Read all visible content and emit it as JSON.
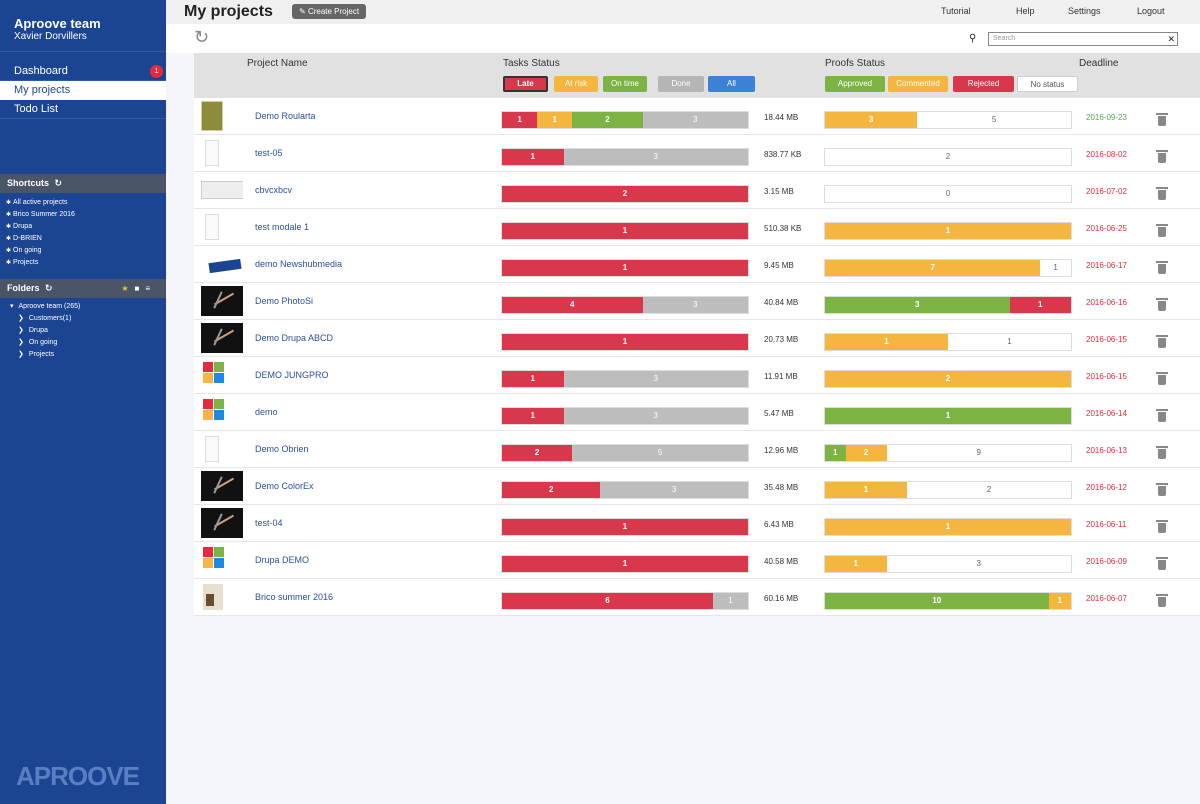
{
  "sidebar": {
    "team_name": "Aproove team",
    "user_name": "Xavier Dorvillers",
    "nav": [
      {
        "label": "Dashboard",
        "badge": "1"
      },
      {
        "label": "My projects"
      },
      {
        "label": "Todo List"
      }
    ],
    "shortcuts_title": "Shortcuts",
    "shortcuts": [
      "All active projects",
      "Brico Summer 2016",
      "Drupa",
      "D-BRIEN",
      "On going",
      "Projects"
    ],
    "folders_title": "Folders",
    "folder_root": "Aproove team (265)",
    "folders": [
      "Customers(1)",
      "Drupa",
      "On going",
      "Projects"
    ],
    "logo": "APROOVE"
  },
  "topbar": {
    "title": "My projects",
    "create_label": "Create Project",
    "links": [
      "Tutorial",
      "Help",
      "Settings",
      "Logout"
    ]
  },
  "search": {
    "placeholder": "Search"
  },
  "header": {
    "project_name": "Project Name",
    "tasks_status": "Tasks Status",
    "proofs_status": "Proofs Status",
    "deadline": "Deadline",
    "task_filters": [
      {
        "label": "Late",
        "color": "#d9374b",
        "selected": true
      },
      {
        "label": "At risk",
        "color": "#f4b63f"
      },
      {
        "label": "On time",
        "color": "#7cb342"
      },
      {
        "label": "Done",
        "color": "#b5b5b5"
      },
      {
        "label": "All",
        "color": "#3b82d6"
      }
    ],
    "proof_filters": [
      {
        "label": "Approved",
        "color": "#7cb342"
      },
      {
        "label": "Commented",
        "color": "#f4b63f"
      },
      {
        "label": "Rejected",
        "color": "#d9374b"
      },
      {
        "label": "No status",
        "color": "#ffffff"
      }
    ]
  },
  "colors": {
    "late": "#d9374b",
    "atrisk": "#f4b63f",
    "ontime": "#7cb342",
    "done": "#bdbdbd",
    "approved": "#7cb342",
    "commented": "#f4b63f",
    "rejected": "#d9374b",
    "nostatus": "#ffffff"
  },
  "projects": [
    {
      "name": "Demo Roularta",
      "thumb": "olive",
      "tasks": [
        [
          "late",
          1
        ],
        [
          "atrisk",
          1
        ],
        [
          "ontime",
          2
        ],
        [
          "done",
          3
        ]
      ],
      "size": "18.44 MB",
      "proofs": [
        [
          "commented",
          3
        ],
        [
          "nostatus",
          5
        ]
      ],
      "deadline": "2016-09-23",
      "deadline_ok": true
    },
    {
      "name": "test-05",
      "thumb": "paper",
      "tasks": [
        [
          "late",
          1
        ],
        [
          "done",
          3
        ]
      ],
      "size": "838.77 KB",
      "proofs": [
        [
          "nostatus",
          2
        ]
      ],
      "deadline": "2016-08-02"
    },
    {
      "name": "cbvcxbcv",
      "thumb": "wide",
      "tasks": [
        [
          "late",
          2
        ]
      ],
      "size": "3.15 MB",
      "proofs": [
        [
          "nostatus",
          0
        ]
      ],
      "deadline": "2016-07-02"
    },
    {
      "name": "test modale 1",
      "thumb": "paper",
      "tasks": [
        [
          "late",
          1
        ]
      ],
      "size": "510.38 KB",
      "proofs": [
        [
          "commented",
          1
        ]
      ],
      "deadline": "2016-06-25"
    },
    {
      "name": "demo Newshubmedia",
      "thumb": "blue",
      "tasks": [
        [
          "late",
          1
        ]
      ],
      "size": "9.45 MB",
      "proofs": [
        [
          "commented",
          7
        ],
        [
          "nostatus",
          1
        ]
      ],
      "deadline": "2016-06-17"
    },
    {
      "name": "Demo PhotoSi",
      "thumb": "dark",
      "tasks": [
        [
          "late",
          4
        ],
        [
          "done",
          3
        ]
      ],
      "size": "40.84 MB",
      "proofs": [
        [
          "approved",
          3
        ],
        [
          "rejected",
          1
        ]
      ],
      "deadline": "2016-06-16"
    },
    {
      "name": "Demo Drupa ABCD",
      "thumb": "dark",
      "tasks": [
        [
          "late",
          1
        ]
      ],
      "size": "20.73 MB",
      "proofs": [
        [
          "commented",
          1
        ],
        [
          "nostatus",
          1
        ]
      ],
      "deadline": "2016-06-15"
    },
    {
      "name": "DEMO JUNGPRO",
      "thumb": "color",
      "tasks": [
        [
          "late",
          1
        ],
        [
          "done",
          3
        ]
      ],
      "size": "11.91 MB",
      "proofs": [
        [
          "commented",
          2
        ]
      ],
      "deadline": "2016-06-15"
    },
    {
      "name": "demo",
      "thumb": "color",
      "tasks": [
        [
          "late",
          1
        ],
        [
          "done",
          3
        ]
      ],
      "size": "5.47 MB",
      "proofs": [
        [
          "approved",
          1
        ]
      ],
      "deadline": "2016-06-14"
    },
    {
      "name": "Demo Obrien",
      "thumb": "paper",
      "tasks": [
        [
          "late",
          2
        ],
        [
          "done",
          5
        ]
      ],
      "size": "12.96 MB",
      "proofs": [
        [
          "approved",
          1
        ],
        [
          "commented",
          2
        ],
        [
          "nostatus",
          9
        ]
      ],
      "deadline": "2016-06-13"
    },
    {
      "name": "Demo ColorEx",
      "thumb": "dark",
      "tasks": [
        [
          "late",
          2
        ],
        [
          "done",
          3
        ]
      ],
      "size": "35.48 MB",
      "proofs": [
        [
          "commented",
          1
        ],
        [
          "nostatus",
          2
        ]
      ],
      "deadline": "2016-06-12"
    },
    {
      "name": "test-04",
      "thumb": "dark",
      "tasks": [
        [
          "late",
          1
        ]
      ],
      "size": "6.43 MB",
      "proofs": [
        [
          "commented",
          1
        ]
      ],
      "deadline": "2016-06-11"
    },
    {
      "name": "Drupa DEMO",
      "thumb": "color",
      "tasks": [
        [
          "late",
          1
        ]
      ],
      "size": "40.58 MB",
      "proofs": [
        [
          "commented",
          1
        ],
        [
          "nostatus",
          3
        ]
      ],
      "deadline": "2016-06-09"
    },
    {
      "name": "Brico summer 2016",
      "thumb": "brico",
      "tasks": [
        [
          "late",
          6
        ],
        [
          "done",
          1
        ]
      ],
      "size": "60.16 MB",
      "proofs": [
        [
          "approved",
          10
        ],
        [
          "commented",
          1
        ]
      ],
      "deadline": "2016-06-07"
    }
  ]
}
